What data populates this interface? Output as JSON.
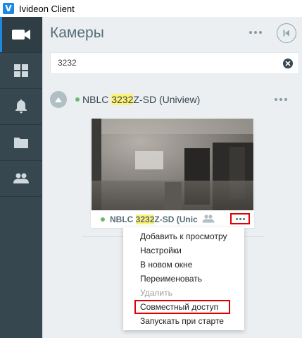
{
  "window": {
    "logo_letter": "V",
    "title": "Ivideon Client"
  },
  "sidebar": {
    "items": [
      {
        "id": "cameras",
        "icon": "video-camera-icon",
        "active": true
      },
      {
        "id": "layouts",
        "icon": "grid-icon",
        "active": false
      },
      {
        "id": "events",
        "icon": "bell-icon",
        "active": false
      },
      {
        "id": "archive",
        "icon": "folder-icon",
        "active": false
      },
      {
        "id": "users",
        "icon": "people-icon",
        "active": false
      }
    ]
  },
  "header": {
    "title": "Камеры",
    "more_icon": "more-horizontal-icon",
    "collapse_icon": "collapse-left-icon"
  },
  "search": {
    "value": "3232",
    "clear_icon": "clear-icon"
  },
  "camera_group": {
    "name_prefix": "NBLC ",
    "name_highlight": "3232",
    "name_suffix": "Z-SD (Uniview)",
    "status_color": "#66bb6a"
  },
  "camera_card": {
    "label_prefix": "NBLC ",
    "label_highlight": "3232",
    "label_suffix": "Z-SD (Unic",
    "shared_icon": "shared-users-icon"
  },
  "context_menu": {
    "items": [
      {
        "label": "Добавить к просмотру",
        "disabled": false,
        "highlighted": false
      },
      {
        "label": "Настройки",
        "disabled": false,
        "highlighted": false
      },
      {
        "label": "В новом окне",
        "disabled": false,
        "highlighted": false
      },
      {
        "label": "Переименовать",
        "disabled": false,
        "highlighted": false
      },
      {
        "label": "Удалить",
        "disabled": true,
        "highlighted": false
      },
      {
        "label": "Совместный доступ",
        "disabled": false,
        "highlighted": true
      },
      {
        "label": "Запускать при старте",
        "disabled": false,
        "highlighted": false
      }
    ]
  },
  "colors": {
    "accent": "#1e88e5",
    "sidebar": "#37474f",
    "annotation_box": "#e00000",
    "highlight": "#fff176"
  }
}
